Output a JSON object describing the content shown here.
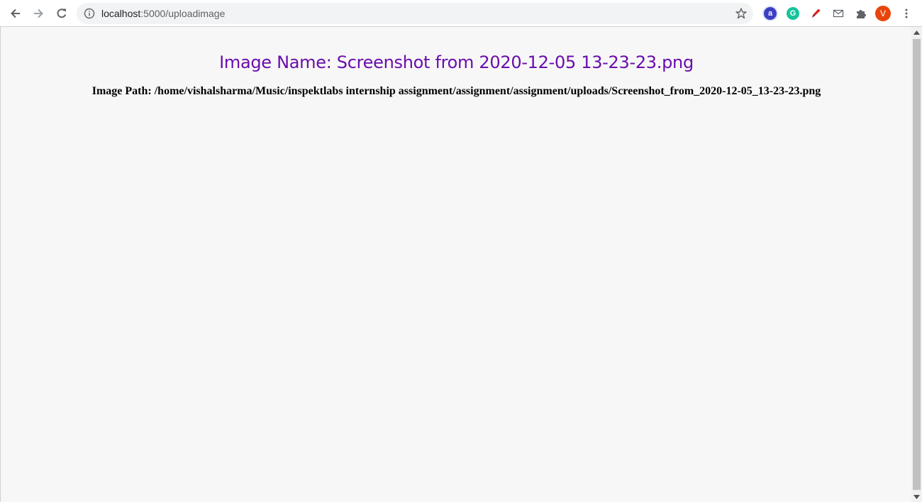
{
  "browser": {
    "url_host": "localhost",
    "url_path": ":5000/uploadimage",
    "profile_initial": "V",
    "icons": {
      "back": "back-arrow-icon",
      "forward": "forward-arrow-icon",
      "reload": "reload-icon",
      "site_info": "info-icon",
      "bookmark": "star-icon",
      "extensions": "puzzle-icon",
      "menu": "kebab-menu-icon"
    },
    "extension_badges": {
      "ext_a": "a",
      "ext_g": "G"
    }
  },
  "page": {
    "heading": "Image Name: Screenshot from 2020-12-05 13-23-23.png",
    "path_text": "Image Path: /home/vishalsharma/Music/inspektlabs internship assignment/assignment/assignment/uploads/Screenshot_from_2020-12-05_13-23-23.png"
  },
  "colors": {
    "heading": "#6a0dad",
    "page_background": "#f7f7f7",
    "avatar": "#e8450c",
    "grammarly": "#15c39a"
  }
}
